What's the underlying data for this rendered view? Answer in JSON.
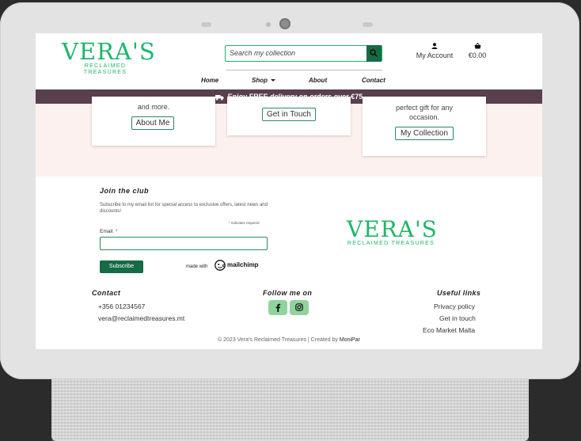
{
  "header": {
    "logo_main": "VERA'S",
    "logo_sub": "RECLAIMED TREASURES",
    "search_placeholder": "Search my collection",
    "account_label": "My Account",
    "cart_total": "€0.00"
  },
  "nav": {
    "home": "Home",
    "shop": "Shop",
    "about": "About",
    "contact": "Contact"
  },
  "banner": {
    "text": "Enjoy FREE delivery on orders over €75"
  },
  "cards": {
    "about_text": "and more.",
    "about_button": "About Me",
    "contact_button": "Get in Touch",
    "collection_text_1": "perfect gift for any",
    "collection_text_2": "occasion.",
    "collection_button": "My Collection"
  },
  "newsletter": {
    "title": "Join the club",
    "description": "Subscribe to my email list for special access to exclusive offers, latest news and discounts!",
    "required_note": "indicates required",
    "email_label": "Email:",
    "subscribe_button": "Subscribe",
    "made_with": "made with",
    "mailchimp": "mailchimp"
  },
  "footer": {
    "contact_title": "Contact",
    "phone": "+356 01234567",
    "email": "vera@reclaimedtreasures.mt",
    "follow_title": "Follow me on",
    "links_title": "Useful links",
    "link_privacy": "Privacy policy",
    "link_touch": "Get in touch",
    "link_eco": "Eco Market Malta",
    "copyright": "© 2023 Vera's Reclaimed Treasures | Created by",
    "author": "MoniPar"
  },
  "colors": {
    "brand_green": "#1fb56a",
    "dark_green": "#156b46",
    "banner_plum": "#5a3f4e",
    "social_green": "#8fd39f"
  }
}
